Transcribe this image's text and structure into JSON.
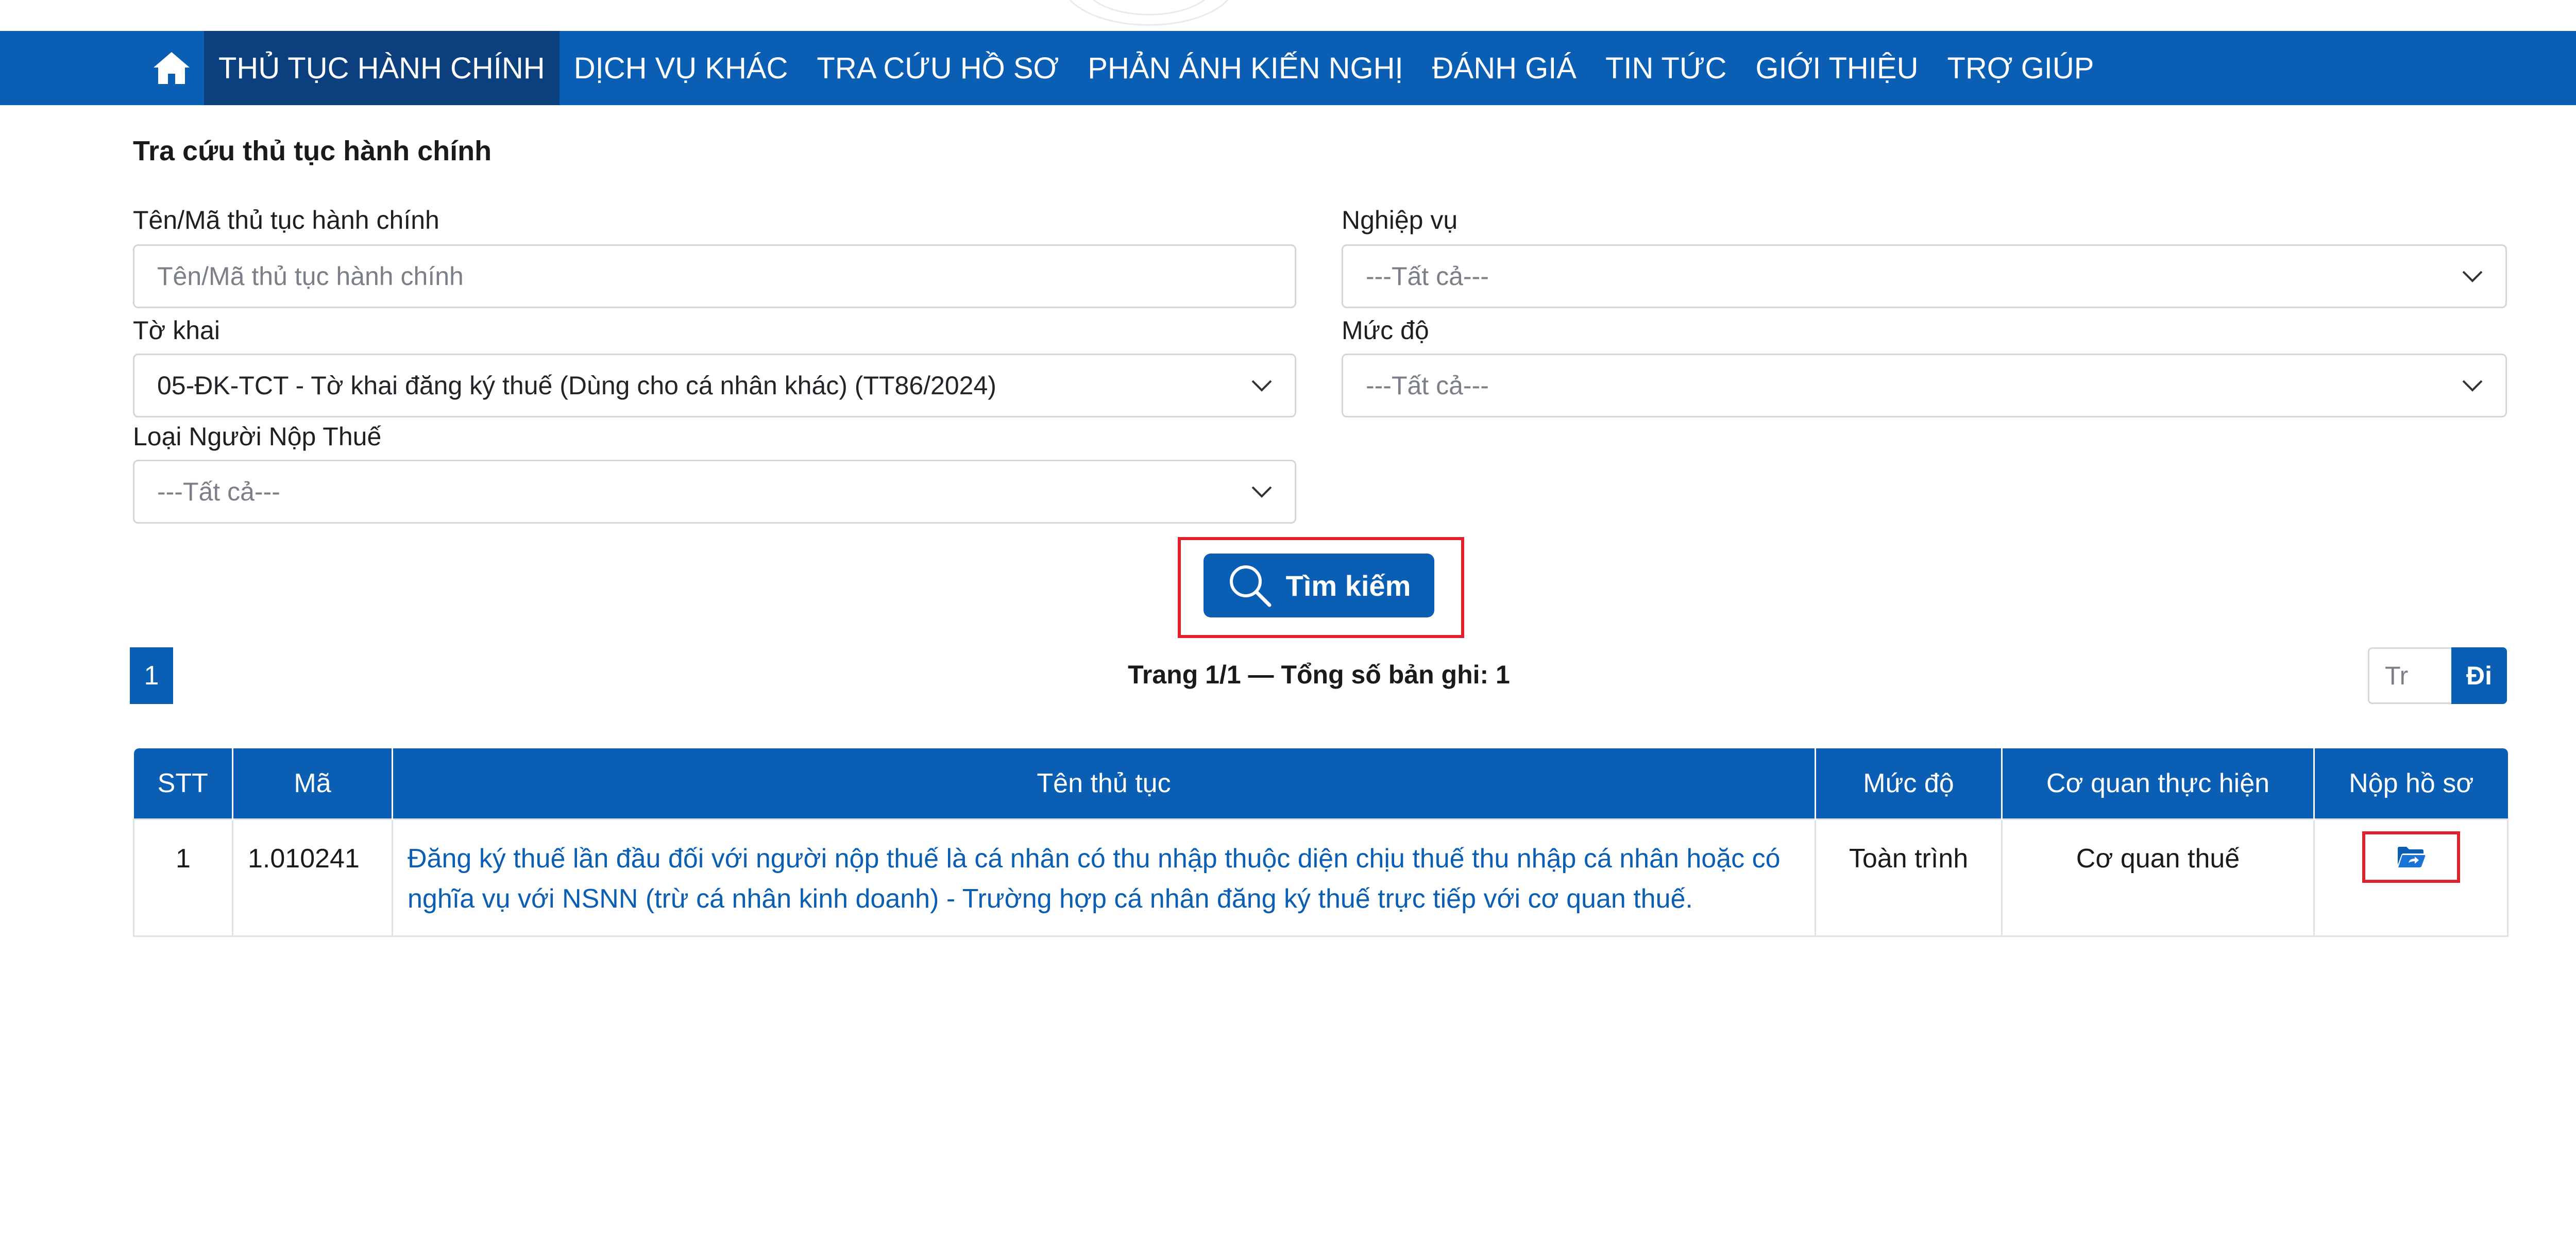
{
  "nav": {
    "items": [
      {
        "label": "THỦ TỤC HÀNH CHÍNH",
        "active": true
      },
      {
        "label": "DỊCH VỤ KHÁC",
        "active": false
      },
      {
        "label": "TRA CỨU HỒ SƠ",
        "active": false
      },
      {
        "label": "PHẢN ÁNH KIẾN NGHỊ",
        "active": false
      },
      {
        "label": "ĐÁNH GIÁ",
        "active": false
      },
      {
        "label": "TIN TỨC",
        "active": false
      },
      {
        "label": "GIỚI THIỆU",
        "active": false
      },
      {
        "label": "TRỢ GIÚP",
        "active": false
      }
    ],
    "home_icon": "home-icon"
  },
  "page": {
    "title": "Tra cứu thủ tục hành chính"
  },
  "form": {
    "name_label": "Tên/Mã thủ tục hành chính",
    "name_placeholder": "Tên/Mã thủ tục hành chính",
    "nghiep_vu_label": "Nghiệp vụ",
    "nghiep_vu_value": "---Tất cả---",
    "to_khai_label": "Tờ khai",
    "to_khai_value": "05-ĐK-TCT - Tờ khai đăng ký thuế (Dùng cho cá nhân khác) (TT86/2024)",
    "muc_do_label": "Mức độ",
    "muc_do_value": "---Tất cả---",
    "loai_nnt_label": "Loại Người Nộp Thuế",
    "loai_nnt_value": "---Tất cả---",
    "search_label": "Tìm kiếm"
  },
  "pagination": {
    "current_page": "1",
    "info": "Trang 1/1 — Tổng số bản ghi: 1",
    "goto_placeholder": "Tr",
    "goto_label": "Đi"
  },
  "table": {
    "headers": [
      "STT",
      "Mã",
      "Tên thủ tục",
      "Mức độ",
      "Cơ quan thực hiện",
      "Nộp hồ sơ"
    ],
    "rows": [
      {
        "stt": "1",
        "ma": "1.010241",
        "ten": "Đăng ký thuế lần đầu đối với người nộp thuế là cá nhân có thu nhập thuộc diện chịu thuế thu nhập cá nhân hoặc có nghĩa vụ với NSNN (trừ cá nhân kinh doanh) - Trường hợp cá nhân đăng ký thuế trực tiếp với cơ quan thuế.",
        "muc_do": "Toàn trình",
        "co_quan": "Cơ quan thuế",
        "nop_icon": "folder-open-icon"
      }
    ]
  },
  "colors": {
    "primary": "#0a5fb4",
    "nav_active": "#0b3f7d",
    "highlight": "#e0202a"
  }
}
